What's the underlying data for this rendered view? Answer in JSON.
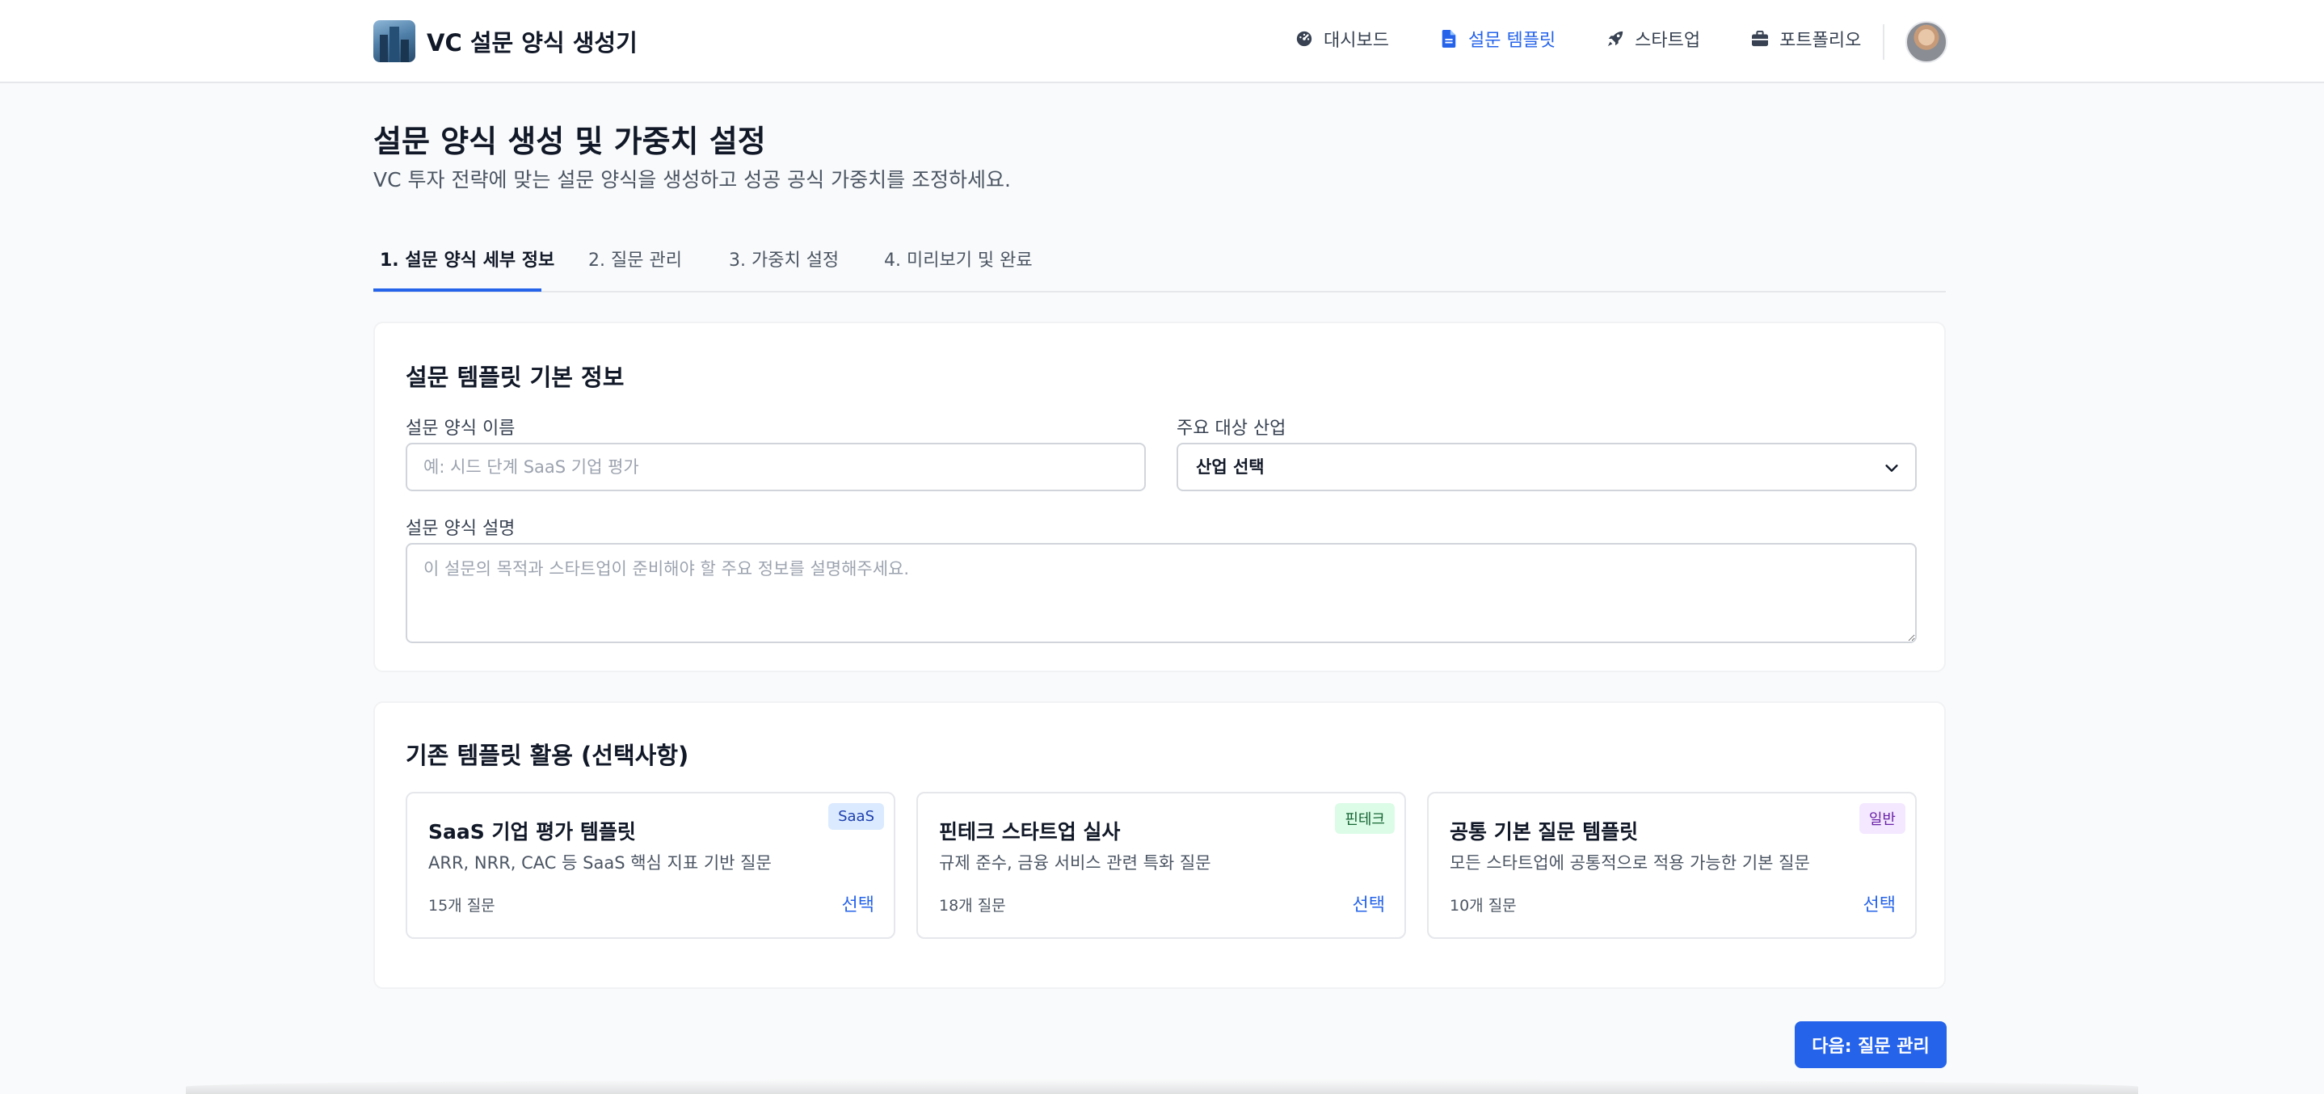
{
  "header": {
    "brand_title": "VC 설문 양식 생성기",
    "nav": [
      {
        "label": "대시보드",
        "icon": "dashboard-gauge-icon",
        "active": false
      },
      {
        "label": "설문 템플릿",
        "icon": "file-document-icon",
        "active": true
      },
      {
        "label": "스타트업",
        "icon": "rocket-icon",
        "active": false
      },
      {
        "label": "포트폴리오",
        "icon": "briefcase-icon",
        "active": false
      }
    ]
  },
  "page": {
    "title": "설문 양식 생성 및 가중치 설정",
    "subtitle": "VC 투자 전략에 맞는 설문 양식을 생성하고 성공 공식 가중치를 조정하세요."
  },
  "tabs": [
    {
      "label": "1. 설문 양식 세부 정보",
      "active": true
    },
    {
      "label": "2. 질문 관리",
      "active": false
    },
    {
      "label": "3. 가중치 설정",
      "active": false
    },
    {
      "label": "4. 미리보기 및 완료",
      "active": false
    }
  ],
  "basic_info": {
    "title": "설문 템플릿 기본 정보",
    "name_label": "설문 양식 이름",
    "name_placeholder": "예: 시드 단계 SaaS 기업 평가",
    "industry_label": "주요 대상 산업",
    "industry_selected": "산업 선택",
    "description_label": "설문 양식 설명",
    "description_placeholder": "이 설문의 목적과 스타트업이 준비해야 할 주요 정보를 설명해주세요."
  },
  "existing_templates": {
    "title": "기존 템플릿 활용 (선택사항)",
    "items": [
      {
        "name": "SaaS 기업 평가 템플릿",
        "badge": "SaaS",
        "description": "ARR, NRR, CAC 등 SaaS 핵심 지표 기반 질문",
        "count": "15개 질문",
        "action": "선택",
        "badge_bg": "#dbeafe",
        "badge_fg": "#1e40af"
      },
      {
        "name": "핀테크 스타트업 실사",
        "badge": "핀테크",
        "description": "규제 준수, 금융 서비스 관련 특화 질문",
        "count": "18개 질문",
        "action": "선택",
        "badge_bg": "#dcfce7",
        "badge_fg": "#166534"
      },
      {
        "name": "공통 기본 질문 템플릿",
        "badge": "일반",
        "description": "모든 스타트업에 공통적으로 적용 가능한 기본 질문",
        "count": "10개 질문",
        "action": "선택",
        "badge_bg": "#f3e8ff",
        "badge_fg": "#6b21a8"
      }
    ]
  },
  "footer": {
    "next_label": "다음: 질문 관리"
  },
  "colors": {
    "accent": "#2563eb",
    "background": "#f9fafb"
  }
}
